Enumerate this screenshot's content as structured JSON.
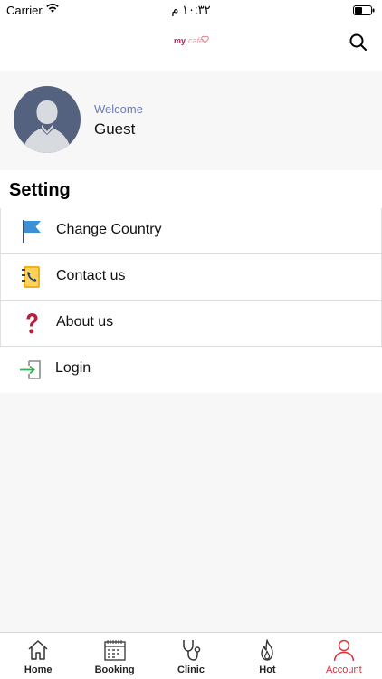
{
  "status_bar": {
    "carrier": "Carrier",
    "time": "١٠:٣٢ م"
  },
  "header": {
    "logo_part1": "my",
    "logo_part2": "cafe",
    "search_icon": "search-icon"
  },
  "profile": {
    "welcome": "Welcome",
    "name": "Guest"
  },
  "settings": {
    "title": "Setting",
    "items": [
      {
        "label": "Change Country",
        "icon": "flag-icon"
      },
      {
        "label": "Contact us",
        "icon": "phone-book-icon"
      },
      {
        "label": "About us",
        "icon": "question-icon"
      },
      {
        "label": "Login",
        "icon": "login-icon"
      }
    ]
  },
  "tabs": [
    {
      "label": "Home",
      "icon": "home-icon"
    },
    {
      "label": "Booking",
      "icon": "calendar-icon"
    },
    {
      "label": "Clinic",
      "icon": "stethoscope-icon"
    },
    {
      "label": "Hot",
      "icon": "flame-icon"
    },
    {
      "label": "Account",
      "icon": "user-icon",
      "active": true
    }
  ],
  "colors": {
    "accent": "#d9323b",
    "avatar_bg": "#55627f",
    "welcome": "#6c7bb6"
  }
}
